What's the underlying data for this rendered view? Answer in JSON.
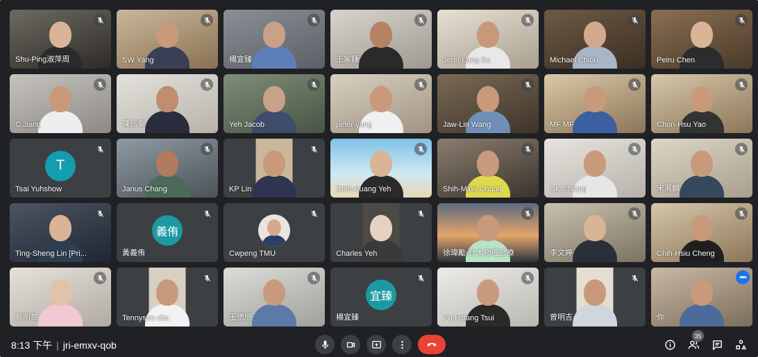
{
  "meeting": {
    "time": "8:13 下午",
    "separator": "|",
    "code": "jri-emxv-qob",
    "participant_count": "35"
  },
  "colors": {
    "tile_bg": "#3c4043",
    "accent": "#1a73e8",
    "end_call": "#ea4335",
    "avatar_teal": "#129eaf"
  },
  "participants": [
    {
      "name": "Shu-Ping淑萍周"
    },
    {
      "name": "SW Yang"
    },
    {
      "name": "楊宜臻"
    },
    {
      "name": "王家鍾"
    },
    {
      "name": "Jenn-Lung Su"
    },
    {
      "name": "Michael Chiou"
    },
    {
      "name": "Peiru Chen"
    },
    {
      "name": "C Jiang"
    },
    {
      "name": "陳信泰"
    },
    {
      "name": "Yeh Jacob"
    },
    {
      "name": "peter yang"
    },
    {
      "name": "Jaw-Lin Wang"
    },
    {
      "name": "MF MF"
    },
    {
      "name": "Chun-Hsu Yao"
    },
    {
      "name": "Tsai Yuhshow",
      "initial": "T"
    },
    {
      "name": "Janus Chang"
    },
    {
      "name": "KP Lin"
    },
    {
      "name": "Chih-Kuang Yeh"
    },
    {
      "name": "Shih-Ming Chang"
    },
    {
      "name": "CK Chiang"
    },
    {
      "name": "宋湘麟"
    },
    {
      "name": "Ting-Sheng Lin [Pri..."
    },
    {
      "name": "黃義侑",
      "initial": "義侑"
    },
    {
      "name": "Cwpeng TMU"
    },
    {
      "name": "Charles Yeh"
    },
    {
      "name": "徐瑋勵-台大物理治療"
    },
    {
      "name": "李文婷"
    },
    {
      "name": "Chih-Hsiu Cheng"
    },
    {
      "name": "蔡明慈"
    },
    {
      "name": "Tennyson chu"
    },
    {
      "name": "王德順"
    },
    {
      "name": "楊宜臻",
      "initial": "宜臻"
    },
    {
      "name": "Po-Hsiang Tsui"
    },
    {
      "name": "曾明吉"
    },
    {
      "name": "你"
    }
  ],
  "icons": {
    "mic": "mic-icon",
    "camera": "camera-icon",
    "present": "present-icon",
    "more": "more-vert-icon",
    "end": "end-call-icon",
    "info": "info-icon",
    "people": "people-icon",
    "chat": "chat-icon",
    "activities": "activities-icon",
    "muted": "mic-off-icon"
  }
}
